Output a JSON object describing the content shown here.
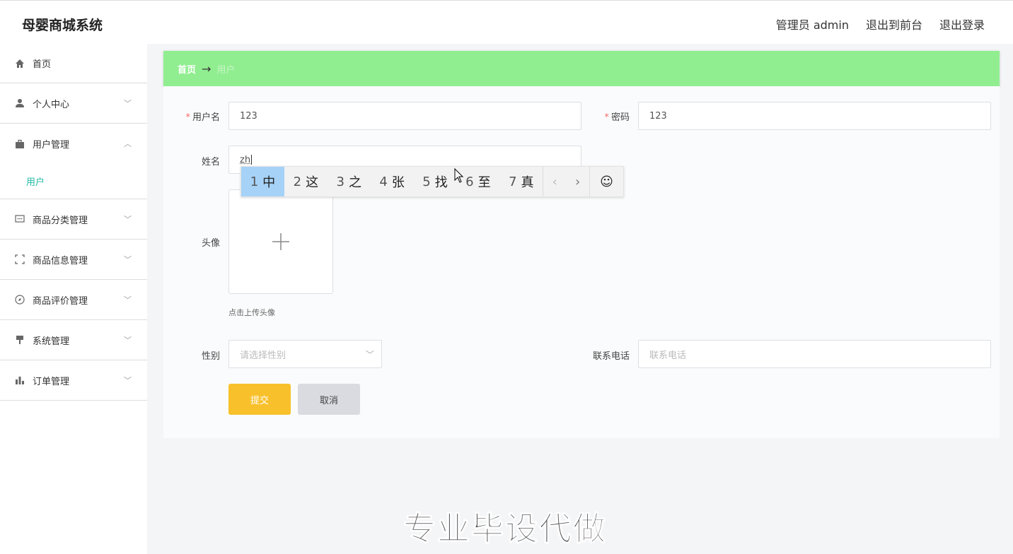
{
  "app": {
    "title": "母婴商城系统"
  },
  "header": {
    "admin_label": "管理员 admin",
    "to_front": "退出到前台",
    "logout": "退出登录"
  },
  "sidebar": {
    "items": [
      {
        "label": "首页",
        "icon": "home-icon"
      },
      {
        "label": "个人中心",
        "icon": "user-icon"
      },
      {
        "label": "用户管理",
        "icon": "briefcase-icon",
        "expanded": true
      },
      {
        "label": "商品分类管理",
        "icon": "chat-icon"
      },
      {
        "label": "商品信息管理",
        "icon": "frame-icon"
      },
      {
        "label": "商品评价管理",
        "icon": "compass-icon"
      },
      {
        "label": "系统管理",
        "icon": "brush-icon"
      },
      {
        "label": "订单管理",
        "icon": "bar-chart-icon"
      }
    ],
    "submenu": {
      "label": "用户"
    }
  },
  "breadcrumb": {
    "home": "首页",
    "arrow": "→",
    "current": "用户"
  },
  "form": {
    "username": {
      "label": "用户名",
      "value": "123"
    },
    "password": {
      "label": "密码",
      "value": "123"
    },
    "name": {
      "label": "姓名",
      "value": "zh"
    },
    "avatar": {
      "label": "头像",
      "hint": "点击上传头像"
    },
    "gender": {
      "label": "性别",
      "placeholder": "请选择性别"
    },
    "phone": {
      "label": "联系电话",
      "placeholder": "联系电话"
    },
    "submit_label": "提交",
    "cancel_label": "取消"
  },
  "ime": {
    "candidates": [
      {
        "num": "1",
        "char": "中"
      },
      {
        "num": "2",
        "char": "这"
      },
      {
        "num": "3",
        "char": "之"
      },
      {
        "num": "4",
        "char": "张"
      },
      {
        "num": "5",
        "char": "找"
      },
      {
        "num": "6",
        "char": "至"
      },
      {
        "num": "7",
        "char": "真"
      }
    ],
    "prev": "‹",
    "next": "›",
    "emoji": "☺"
  },
  "watermark": "专业毕设代做",
  "colors": {
    "breadcrumb_bg": "#90ee90",
    "submit_bg": "#f8c12c",
    "active_submenu": "#23b8a6",
    "required_star": "#f56c6c"
  }
}
